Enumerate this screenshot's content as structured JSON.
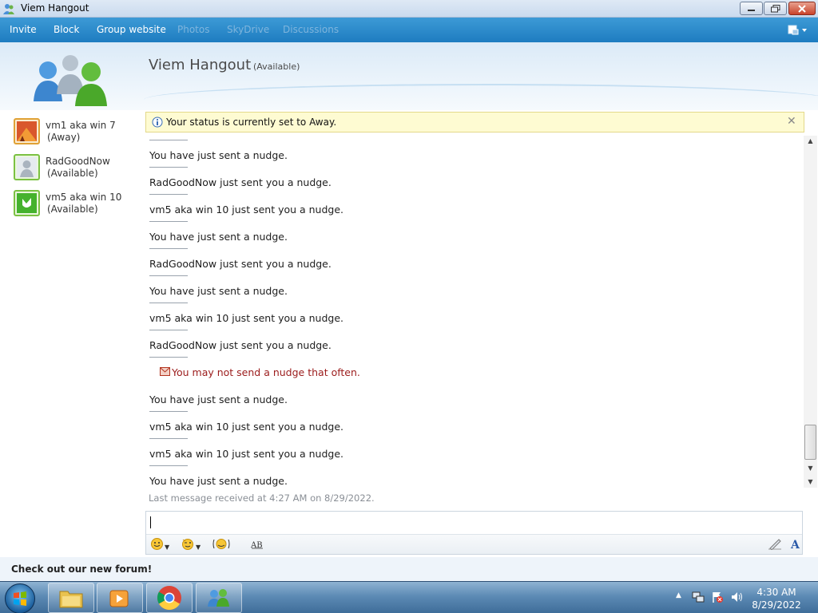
{
  "window": {
    "title": "Viem Hangout"
  },
  "menu": {
    "items": [
      {
        "label": "Invite",
        "enabled": true
      },
      {
        "label": "Block",
        "enabled": true
      },
      {
        "label": "Group website",
        "enabled": true
      },
      {
        "label": "Photos",
        "enabled": false
      },
      {
        "label": "SkyDrive",
        "enabled": false
      },
      {
        "label": "Discussions",
        "enabled": false
      }
    ]
  },
  "header": {
    "title": "Viem Hangout",
    "status": "(Available)"
  },
  "contacts": [
    {
      "name": "vm1 aka win 7",
      "status": "(Away)"
    },
    {
      "name": "RadGoodNow",
      "status": "(Available)"
    },
    {
      "name": "vm5 aka win 10",
      "status": "(Available)"
    }
  ],
  "infobar": {
    "message": "Your status is currently set to Away."
  },
  "chat": {
    "messages": [
      {
        "text": "You have just sent a nudge.",
        "type": "normal"
      },
      {
        "text": "RadGoodNow just sent you a nudge.",
        "type": "normal"
      },
      {
        "text": "vm5 aka win 10 just sent you a nudge.",
        "type": "normal"
      },
      {
        "text": "You have just sent a nudge.",
        "type": "normal"
      },
      {
        "text": "RadGoodNow just sent you a nudge.",
        "type": "normal"
      },
      {
        "text": "You have just sent a nudge.",
        "type": "normal"
      },
      {
        "text": "vm5 aka win 10 just sent you a nudge.",
        "type": "normal"
      },
      {
        "text": "RadGoodNow just sent you a nudge.",
        "type": "normal"
      },
      {
        "text": "You may not send a nudge that often.",
        "type": "warning"
      },
      {
        "text": "You have just sent a nudge.",
        "type": "normal"
      },
      {
        "text": "vm5 aka win 10 just sent you a nudge.",
        "type": "normal"
      },
      {
        "text": "vm5 aka win 10 just sent you a nudge.",
        "type": "normal"
      },
      {
        "text": "You have just sent a nudge.",
        "type": "normal"
      }
    ],
    "last_message": "Last message received at 4:27 AM on 8/29/2022."
  },
  "compose": {
    "value": "",
    "tools": [
      "emoticon-icon",
      "wink-icon",
      "nudge-icon",
      "text-style-icon",
      "handwriting-icon",
      "font-icon"
    ]
  },
  "footer": {
    "forum_link": "Check out our new forum!"
  },
  "taskbar": {
    "time": "4:30 AM",
    "date": "8/29/2022",
    "apps": [
      "windows-explorer-icon",
      "media-player-icon",
      "chrome-icon",
      "messenger-icon"
    ]
  },
  "colors": {
    "menu_bar": "#2585c9",
    "warning_text": "#9b1b1b",
    "infobar_bg": "#fefbd2",
    "available": "#7bc142",
    "away": "#e0a135"
  }
}
